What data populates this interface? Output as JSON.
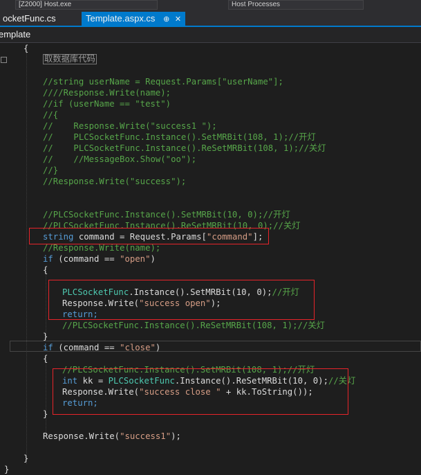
{
  "topbar": {
    "dropdown1": "[Z2000] Host.exe",
    "dropdown2": "Host Processes"
  },
  "tabs": [
    {
      "label": "ocketFunc.cs",
      "active": false
    },
    {
      "label": "Template.aspx.cs",
      "active": true,
      "pin": "⊕",
      "close": "✕"
    }
  ],
  "breadcrumb": "emplate",
  "code": {
    "l0": "{",
    "region": "取数据库代码",
    "l1": "//string userName = Request.Params[\"userName\"];",
    "l2": "////Response.Write(name);",
    "l3": "//if (userName == \"test\")",
    "l4": "//{",
    "l5": "//    Response.Write(\"success1 \");",
    "l6": "//    PLCSocketFunc.Instance().SetMRBit(108, 1);//开灯",
    "l7": "//    PLCSocketFunc.Instance().ReSetMRBit(108, 1);//关灯",
    "l8": "//    //MessageBox.Show(\"oo\");",
    "l9": "//}",
    "l10": "//Response.Write(\"success\");",
    "l11": "//PLCSocketFunc.Instance().SetMRBit(10, 0);//开灯",
    "l12": "//PLCSocketFunc.Instance().ReSetMRBit(10, 0);//关灯",
    "l13_kw": "string",
    "l13_a": " command = Request.Params[",
    "l13_str": "\"command\"",
    "l13_b": "];",
    "l14": "//Response.Write(name);",
    "l15_kw": "if",
    "l15_a": " (command == ",
    "l15_str": "\"open\"",
    "l15_b": ")",
    "l16": "{",
    "l17_t": "PLCSocketFunc",
    "l17_a": ".Instance().SetMRBit(10, 0);",
    "l17_c": "//开灯",
    "l18_a": "Response.Write(",
    "l18_str": "\"success open\"",
    "l18_b": ");",
    "l19": "return;",
    "l20": "//PLCSocketFunc.Instance().ReSetMRBit(108, 1);//关灯",
    "l21": "}",
    "l22_kw": "if",
    "l22_a": " (command == ",
    "l22_str": "\"close\"",
    "l22_b": ")",
    "l23": "{",
    "l24": "//PLCSocketFunc.Instance().SetMRBit(108, 1);//开灯",
    "l25_kw": "int",
    "l25_a": " kk = ",
    "l25_t": "PLCSocketFunc",
    "l25_b": ".Instance().ReSetMRBit(10, 0);",
    "l25_c": "//关灯",
    "l26_a": "Response.Write(",
    "l26_str": "\"success close \"",
    "l26_b": " + kk.ToString());",
    "l27": "return;",
    "l28": "}",
    "l29_a": "Response.Write(",
    "l29_str": "\"success1\"",
    "l29_b": ");",
    "l30": "}",
    "l31": "}"
  }
}
